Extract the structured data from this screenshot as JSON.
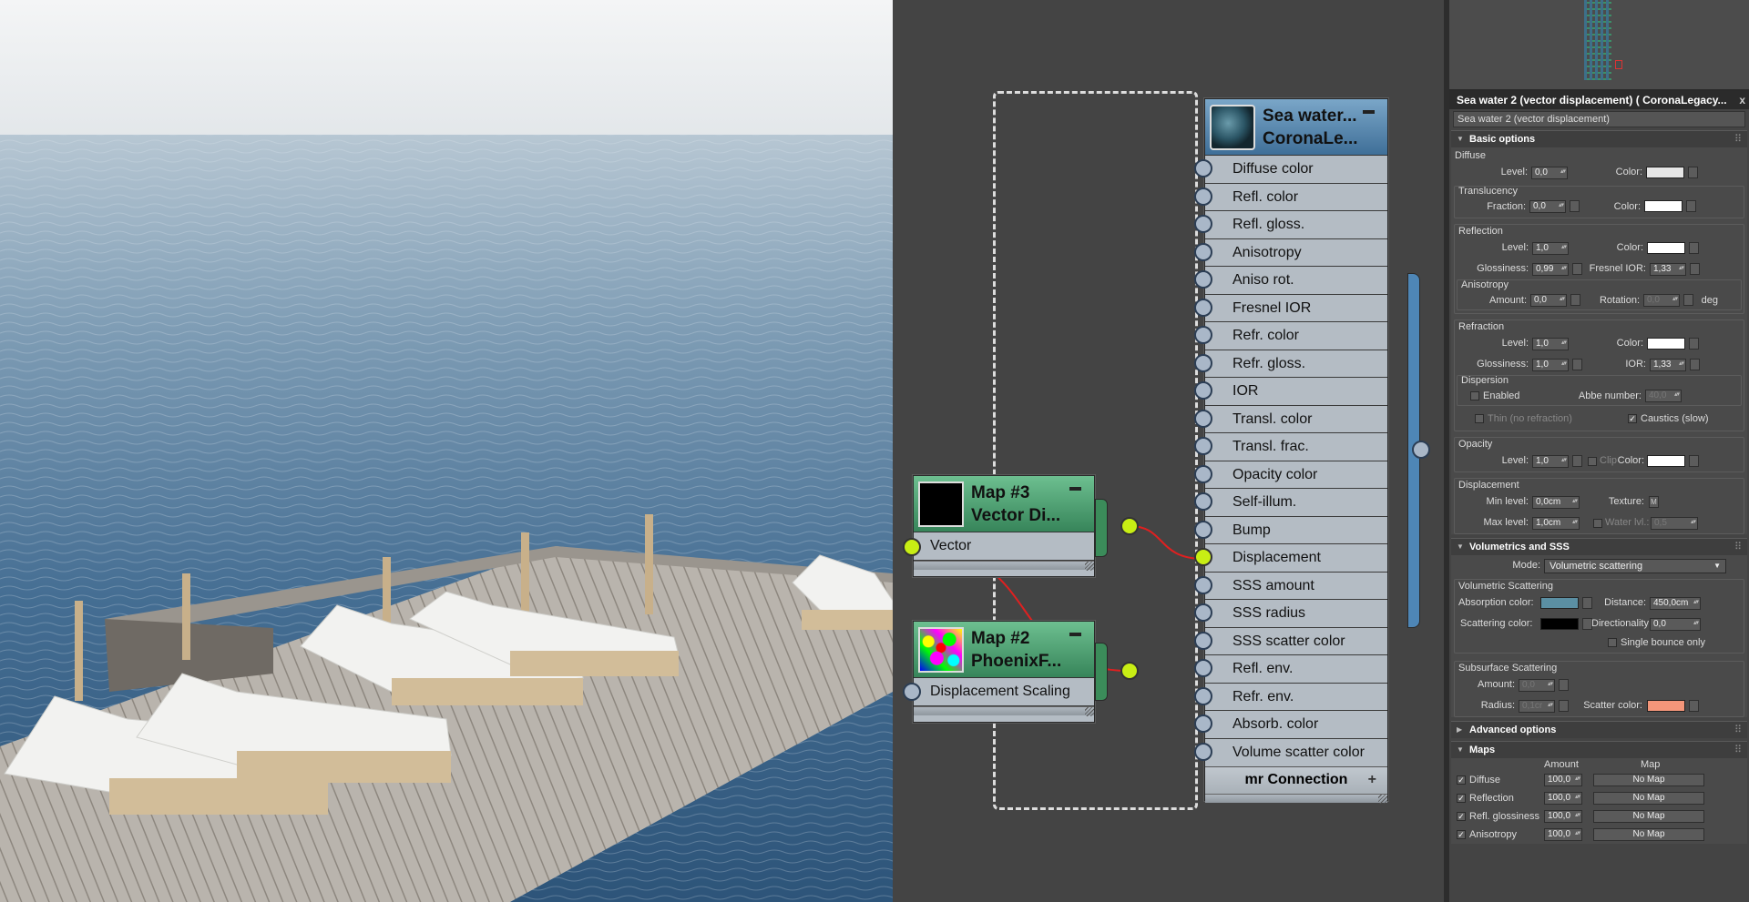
{
  "graph": {
    "sea_node": {
      "title_line1": "Sea water...",
      "title_line2": "CoronaLe...",
      "slots": [
        "Diffuse color",
        "Refl. color",
        "Refl. gloss.",
        "Anisotropy",
        "Aniso rot.",
        "Fresnel IOR",
        "Refr. color",
        "Refr. gloss.",
        "IOR",
        "Transl. color",
        "Transl. frac.",
        "Opacity color",
        "Self-illum.",
        "Bump",
        "Displacement",
        "SSS amount",
        "SSS radius",
        "SSS scatter color",
        "Refl. env.",
        "Refr. env.",
        "Absorb. color",
        "Volume scatter color"
      ],
      "mr_connection": "mr Connection",
      "plus": "+"
    },
    "map3": {
      "title_line1": "Map #3",
      "title_line2": "Vector Di...",
      "slot": "Vector"
    },
    "map2": {
      "title_line1": "Map #2",
      "title_line2": "PhoenixF...",
      "slot": "Displacement Scaling"
    }
  },
  "panel": {
    "title": "Sea water 2 (vector displacement)  ( CoronaLegacy...",
    "close": "x",
    "material_name": "Sea water 2 (vector displacement)",
    "basic_options": "Basic options",
    "diffuse": {
      "label": "Diffuse",
      "level_label": "Level:",
      "level": "0,0",
      "color_label": "Color:",
      "translucency": "Translucency",
      "fraction_label": "Fraction:",
      "fraction": "0,0",
      "t_color_label": "Color:"
    },
    "reflection": {
      "label": "Reflection",
      "level_label": "Level:",
      "level": "1,0",
      "color_label": "Color:",
      "gloss_label": "Glossiness:",
      "gloss": "0,99",
      "fresnel_label": "Fresnel IOR:",
      "fresnel": "1,33",
      "anisotropy": "Anisotropy",
      "amount_label": "Amount:",
      "amount": "0,0",
      "rotation_label": "Rotation:",
      "rotation": "0,0",
      "deg": "deg"
    },
    "refraction": {
      "label": "Refraction",
      "level_label": "Level:",
      "level": "1,0",
      "color_label": "Color:",
      "gloss_label": "Glossiness:",
      "gloss": "1,0",
      "ior_label": "IOR:",
      "ior": "1,33",
      "dispersion": "Dispersion",
      "enabled": "Enabled",
      "abbe_label": "Abbe number:",
      "abbe": "40,0",
      "thin": "Thin (no refraction)",
      "caustics": "Caustics (slow)"
    },
    "opacity": {
      "label": "Opacity",
      "level_label": "Level:",
      "level": "1,0",
      "clip": "Clip",
      "color_label": "Color:"
    },
    "displacement": {
      "label": "Displacement",
      "min_label": "Min level:",
      "min": "0,0cm",
      "texture_label": "Texture:",
      "texture_btn": "M",
      "max_label": "Max level:",
      "max": "1,0cm",
      "water_label": "Water lvl.:",
      "water": "0,5"
    },
    "volumetrics": {
      "label": "Volumetrics and SSS",
      "mode_label": "Mode:",
      "mode": "Volumetric scattering",
      "vs_label": "Volumetric Scattering",
      "absorption_label": "Absorption color:",
      "distance_label": "Distance:",
      "distance": "450,0cm",
      "scattering_label": "Scattering color:",
      "directionality_label": "Directionality:",
      "directionality": "0,0",
      "single_bounce": "Single bounce only",
      "sss_label": "Subsurface Scattering",
      "amount_label": "Amount:",
      "amount": "0,0",
      "radius_label": "Radius:",
      "radius": "0,1cr",
      "scatter_color_label": "Scatter color:"
    },
    "advanced": "Advanced options",
    "maps": {
      "label": "Maps",
      "amount_h": "Amount",
      "map_h": "Map",
      "rows": [
        {
          "name": "Diffuse",
          "amount": "100,0",
          "map": "No Map"
        },
        {
          "name": "Reflection",
          "amount": "100,0",
          "map": "No Map"
        },
        {
          "name": "Refl. glossiness",
          "amount": "100,0",
          "map": "No Map"
        },
        {
          "name": "Anisotropy",
          "amount": "100,0",
          "map": "No Map"
        }
      ]
    }
  },
  "colors": {
    "absorption": "#5b8fa3",
    "scattering": "#000000",
    "scatter_sss": "#f4967a",
    "white": "#ffffff",
    "diffuse": "#e6e6e6"
  }
}
